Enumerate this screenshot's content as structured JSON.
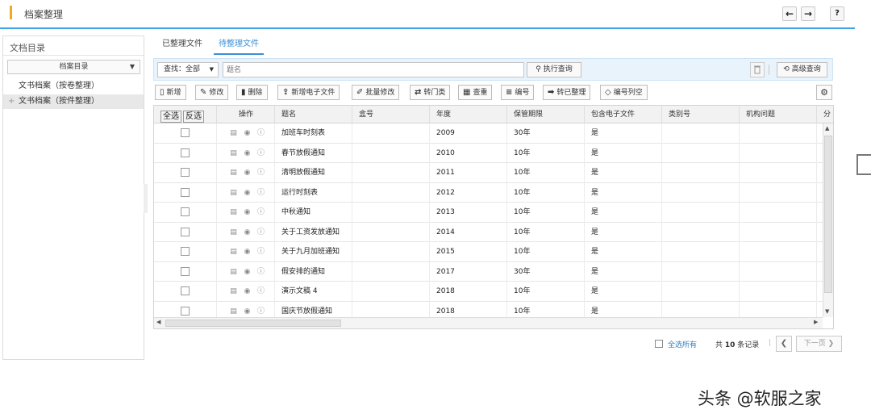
{
  "header": {
    "title": "档案整理"
  },
  "sidebar": {
    "heading": "文档目录",
    "select_value": "档案目录",
    "items": [
      {
        "label": "文书档案（按卷整理）"
      },
      {
        "label": "文书档案（按件整理）",
        "prefix": "+"
      }
    ]
  },
  "tabs": [
    {
      "label": "已整理文件"
    },
    {
      "label": "待整理文件"
    }
  ],
  "search": {
    "scope": "查找：全部",
    "placeholder": "题名",
    "run_label": "执行查询",
    "advanced_label": "高级查询"
  },
  "toolbar": [
    {
      "label": "新增",
      "icon": "new-file-icon",
      "glyph": "▯"
    },
    {
      "label": "修改",
      "icon": "edit-icon",
      "glyph": "✎"
    },
    {
      "label": "删除",
      "icon": "trash-icon",
      "glyph": "▮"
    },
    {
      "label": "新增电子文件",
      "icon": "upload-icon",
      "glyph": "⇪"
    },
    {
      "label": "批量修改",
      "icon": "pencil-icon",
      "glyph": "✐"
    },
    {
      "label": "转门类",
      "icon": "swap-icon",
      "glyph": "⇄"
    },
    {
      "label": "查重",
      "icon": "binoculars-icon",
      "glyph": "▦"
    },
    {
      "label": "编号",
      "icon": "list-icon",
      "glyph": "≡"
    },
    {
      "label": "转已整理",
      "icon": "arrow-right-icon",
      "glyph": "➡"
    },
    {
      "label": "编号列空",
      "icon": "tag-icon",
      "glyph": "◇"
    }
  ],
  "grid": {
    "select_all_label": "全选",
    "invert_label": "反选",
    "columns": [
      "操作",
      "题名",
      "盒号",
      "年度",
      "保管期限",
      "包含电子文件",
      "类别号",
      "机构问题",
      "分"
    ],
    "rows": [
      {
        "title": "加班车时刻表",
        "box": "",
        "year": "2009",
        "period": "30年",
        "has_file": "是"
      },
      {
        "title": "春节放假通知",
        "box": "",
        "year": "2010",
        "period": "10年",
        "has_file": "是"
      },
      {
        "title": "清明放假通知",
        "box": "",
        "year": "2011",
        "period": "10年",
        "has_file": "是"
      },
      {
        "title": "运行时刻表",
        "box": "",
        "year": "2012",
        "period": "10年",
        "has_file": "是"
      },
      {
        "title": "中秋通知",
        "box": "",
        "year": "2013",
        "period": "10年",
        "has_file": "是"
      },
      {
        "title": "关于工资发放通知",
        "box": "",
        "year": "2014",
        "period": "10年",
        "has_file": "是"
      },
      {
        "title": "关于九月加班通知",
        "box": "",
        "year": "2015",
        "period": "10年",
        "has_file": "是"
      },
      {
        "title": "假安排的通知",
        "box": "",
        "year": "2017",
        "period": "30年",
        "has_file": "是"
      },
      {
        "title": "演示文稿 4",
        "box": "",
        "year": "2018",
        "period": "10年",
        "has_file": "是"
      },
      {
        "title": "国庆节放假通知",
        "box": "",
        "year": "2018",
        "period": "10年",
        "has_file": "是"
      }
    ]
  },
  "footer": {
    "select_all_pages": "全选所有",
    "count_prefix": "共",
    "count": "10",
    "count_suffix": "条记录",
    "next_label": "下一页"
  },
  "watermark": "头条 @软服之家",
  "colors": {
    "accent": "#3fa3e6",
    "title_bar": "#f5a623",
    "link": "#2f7dc0"
  }
}
